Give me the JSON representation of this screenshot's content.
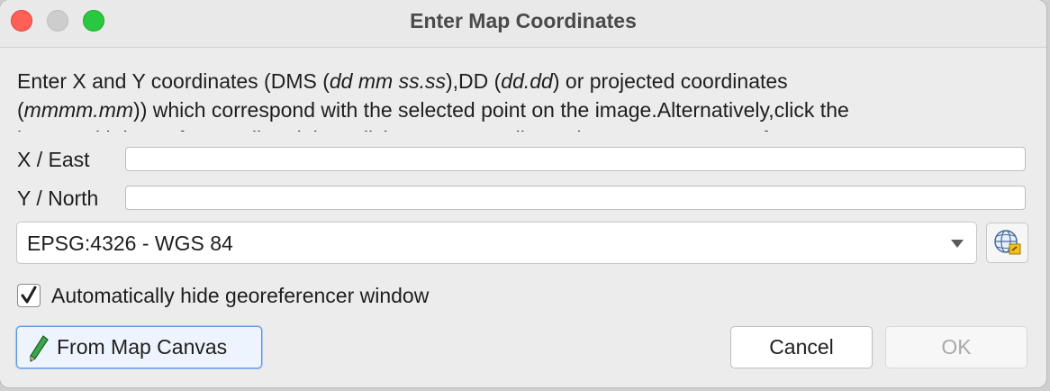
{
  "window": {
    "title": "Enter Map Coordinates"
  },
  "description": {
    "line1_a": "Enter X and Y coordinates (DMS (",
    "line1_dms_format": "dd mm ss.ss",
    "line1_b": "),DD (",
    "line1_dd_format": "dd.dd",
    "line1_c": ") or projected coordinates",
    "line2_a": "(",
    "line2_proj_format": "mmmm.mm",
    "line2_b": ")) which correspond with the selected point on the image.Alternatively,click the",
    "line3": "button with icon of a pencil and then click a corresponding point on map canvas of QGIS to"
  },
  "fields": {
    "x_label": "X / East",
    "x_value": "",
    "y_label": "Y / North",
    "y_value": ""
  },
  "crs": {
    "selected": "EPSG:4326 - WGS 84",
    "button_icon": "globe-crs-icon"
  },
  "options": {
    "auto_hide_label": "Automatically hide georeferencer window",
    "auto_hide_checked": true
  },
  "buttons": {
    "from_map_canvas": "From Map Canvas",
    "from_map_canvas_icon": "pencil-icon",
    "cancel": "Cancel",
    "ok": "OK"
  },
  "colors": {
    "close": "#fe5f57",
    "minimize": "#cdcdcd",
    "maximize": "#28c840",
    "focus_accent": "#5b95e0"
  }
}
